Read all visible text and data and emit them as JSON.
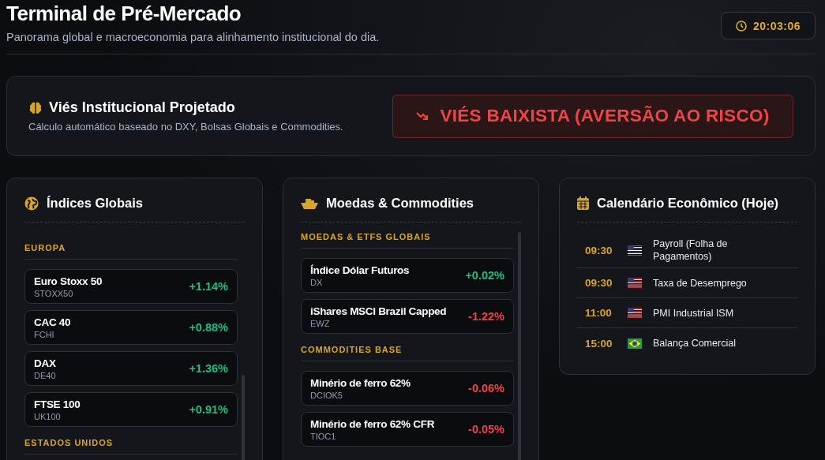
{
  "header": {
    "title": "Terminal de Pré-Mercado",
    "subtitle": "Panorama global e macroeconomia para alinhamento institucional do dia.",
    "clock": "20:03:06"
  },
  "bias": {
    "title": "Viés Institucional Projetado",
    "description": "Cálculo automático baseado no DXY, Bolsas Globais e Commodities.",
    "verdict": "VIÉS BAIXISTA (AVERSÃO AO RISCO)",
    "kind": "bearish"
  },
  "panels": [
    {
      "title": "Índices Globais",
      "kind": "globe",
      "sections": [
        {
          "label": "EUROPA",
          "items": [
            {
              "name": "Euro Stoxx 50",
              "symbol": "STOXX50",
              "change": "+1.14%",
              "kind": "gain"
            },
            {
              "name": "CAC 40",
              "symbol": "FCHI",
              "change": "+0.88%",
              "kind": "gain"
            },
            {
              "name": "DAX",
              "symbol": "DE40",
              "change": "+1.36%",
              "kind": "gain"
            },
            {
              "name": "FTSE 100",
              "symbol": "UK100",
              "change": "+0.91%",
              "kind": "gain"
            }
          ]
        },
        {
          "label": "ESTADOS UNIDOS"
        }
      ]
    },
    {
      "title": "Moedas & Commodities",
      "kind": "ship",
      "sections": [
        {
          "label": "MOEDAS & ETFS GLOBAIS",
          "items": [
            {
              "name": "Índice Dólar Futuros",
              "symbol": "DX",
              "change": "+0.02%",
              "kind": "gain"
            },
            {
              "name": "iShares MSCI Brazil Capped",
              "symbol": "EWZ",
              "change": "-1.22%",
              "kind": "loss"
            }
          ]
        },
        {
          "label": "COMMODITIES BASE",
          "items": [
            {
              "name": "Minério de ferro 62%",
              "symbol": "DCIOK5",
              "change": "-0.06%",
              "kind": "loss"
            },
            {
              "name": "Minério de ferro 62% CFR",
              "symbol": "TIOC1",
              "change": "-0.05%",
              "kind": "loss"
            }
          ]
        }
      ]
    }
  ],
  "calendar": {
    "title": "Calendário Econômico (Hoje)",
    "events": [
      {
        "time": "09:30",
        "kind": "us",
        "event": "Payroll (Folha de Pagamentos)"
      },
      {
        "time": "09:30",
        "kind": "us",
        "event": "Taxa de Desemprego"
      },
      {
        "time": "11:00",
        "kind": "us",
        "event": "PMI Industrial ISM"
      },
      {
        "time": "15:00",
        "kind": "br",
        "event": "Balança Comercial"
      }
    ]
  }
}
